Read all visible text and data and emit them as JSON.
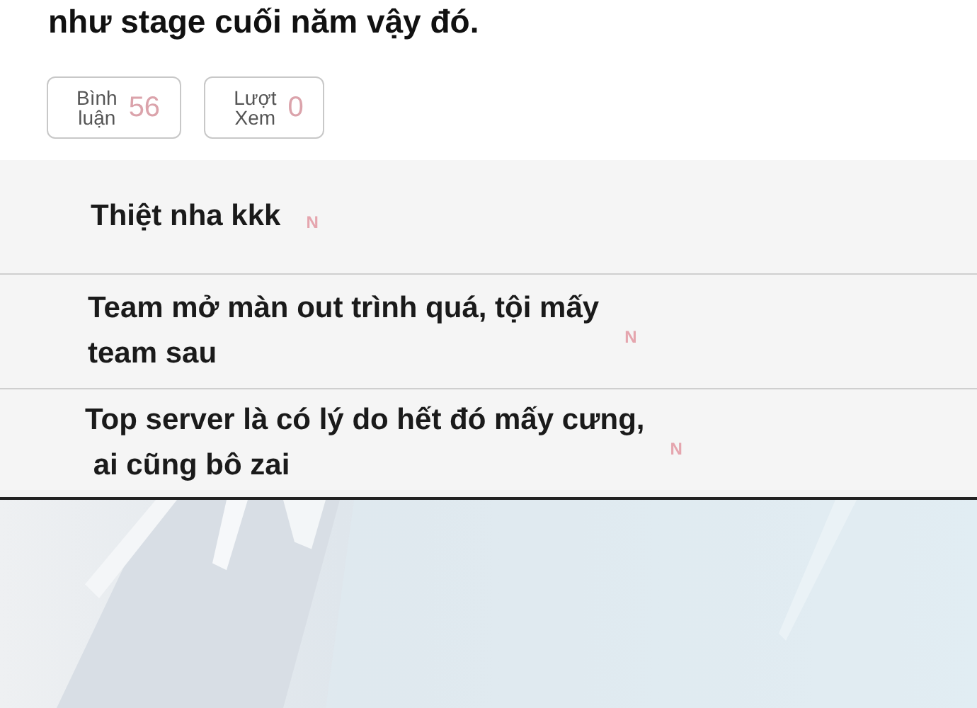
{
  "post": {
    "text_tail": "như stage cuối năm vậy đó."
  },
  "stats": [
    {
      "label_lines": [
        "Bình",
        "luận"
      ],
      "count": "56"
    },
    {
      "label_lines": [
        "Lượt",
        "Xem"
      ],
      "count": "0"
    }
  ],
  "comments": [
    {
      "lines": [
        "Thiệt nha kkk"
      ],
      "badge": "N"
    },
    {
      "lines": [
        "Team mở màn out trình quá, tội mấy",
        "team sau"
      ],
      "badge": "N"
    },
    {
      "lines": [
        "Top server là có lý do hết đó mấy cưng,",
        " ai cũng bô zai"
      ],
      "badge": "N"
    }
  ]
}
